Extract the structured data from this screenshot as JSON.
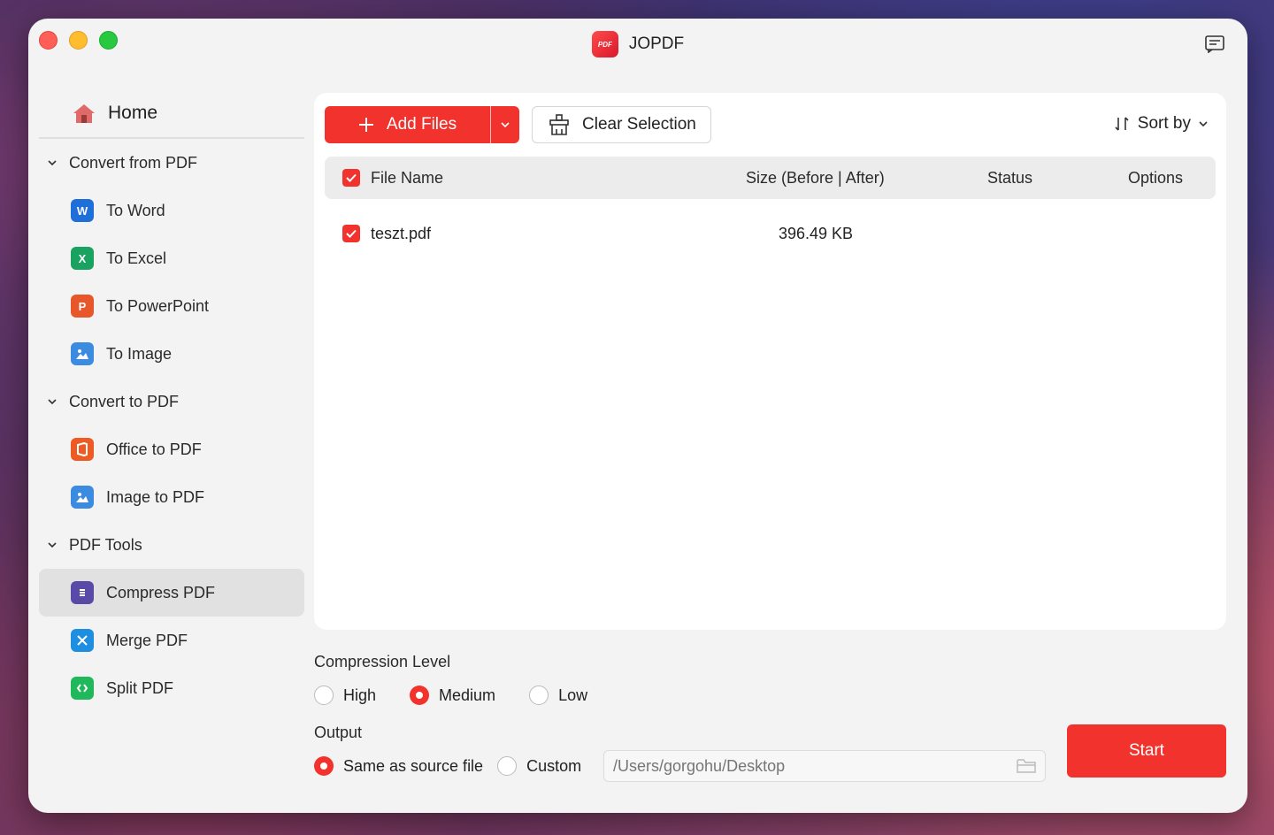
{
  "app": {
    "title": "JOPDF",
    "logo_text": "PDF"
  },
  "sidebar": {
    "home": "Home",
    "groups": [
      {
        "label": "Convert from PDF",
        "items": [
          {
            "label": "To Word",
            "icon": "word-icon",
            "color": "#1e6fd9",
            "glyph": "W"
          },
          {
            "label": "To Excel",
            "icon": "excel-icon",
            "color": "#1aa260",
            "glyph": "X"
          },
          {
            "label": "To PowerPoint",
            "icon": "powerpoint-icon",
            "color": "#e8572a",
            "glyph": "P"
          },
          {
            "label": "To Image",
            "icon": "image-icon",
            "color": "#3b8be0",
            "glyph": ""
          }
        ]
      },
      {
        "label": "Convert to PDF",
        "items": [
          {
            "label": "Office to PDF",
            "icon": "office-icon",
            "color": "#ee5a24",
            "glyph": ""
          },
          {
            "label": "Image to PDF",
            "icon": "image-to-pdf-icon",
            "color": "#3b8be0",
            "glyph": ""
          }
        ]
      },
      {
        "label": "PDF Tools",
        "items": [
          {
            "label": "Compress PDF",
            "icon": "compress-icon",
            "color": "#5a4aa8",
            "glyph": "",
            "active": true
          },
          {
            "label": "Merge PDF",
            "icon": "merge-icon",
            "color": "#1e8fe0",
            "glyph": ""
          },
          {
            "label": "Split PDF",
            "icon": "split-icon",
            "color": "#1fb85a",
            "glyph": ""
          }
        ]
      }
    ]
  },
  "toolbar": {
    "add_files": "Add Files",
    "clear_selection": "Clear Selection",
    "sort_by": "Sort by"
  },
  "table": {
    "headers": {
      "name": "File Name",
      "size": "Size (Before | After)",
      "status": "Status",
      "options": "Options"
    },
    "rows": [
      {
        "name": "teszt.pdf",
        "size": "396.49 KB",
        "status": "",
        "checked": true
      }
    ]
  },
  "compression": {
    "label": "Compression Level",
    "options": [
      "High",
      "Medium",
      "Low"
    ],
    "selected": "Medium"
  },
  "output": {
    "label": "Output",
    "options": [
      "Same as source file",
      "Custom"
    ],
    "selected": "Same as source file",
    "path_placeholder": "/Users/gorgohu/Desktop"
  },
  "start": "Start",
  "colors": {
    "accent": "#f1322d"
  }
}
